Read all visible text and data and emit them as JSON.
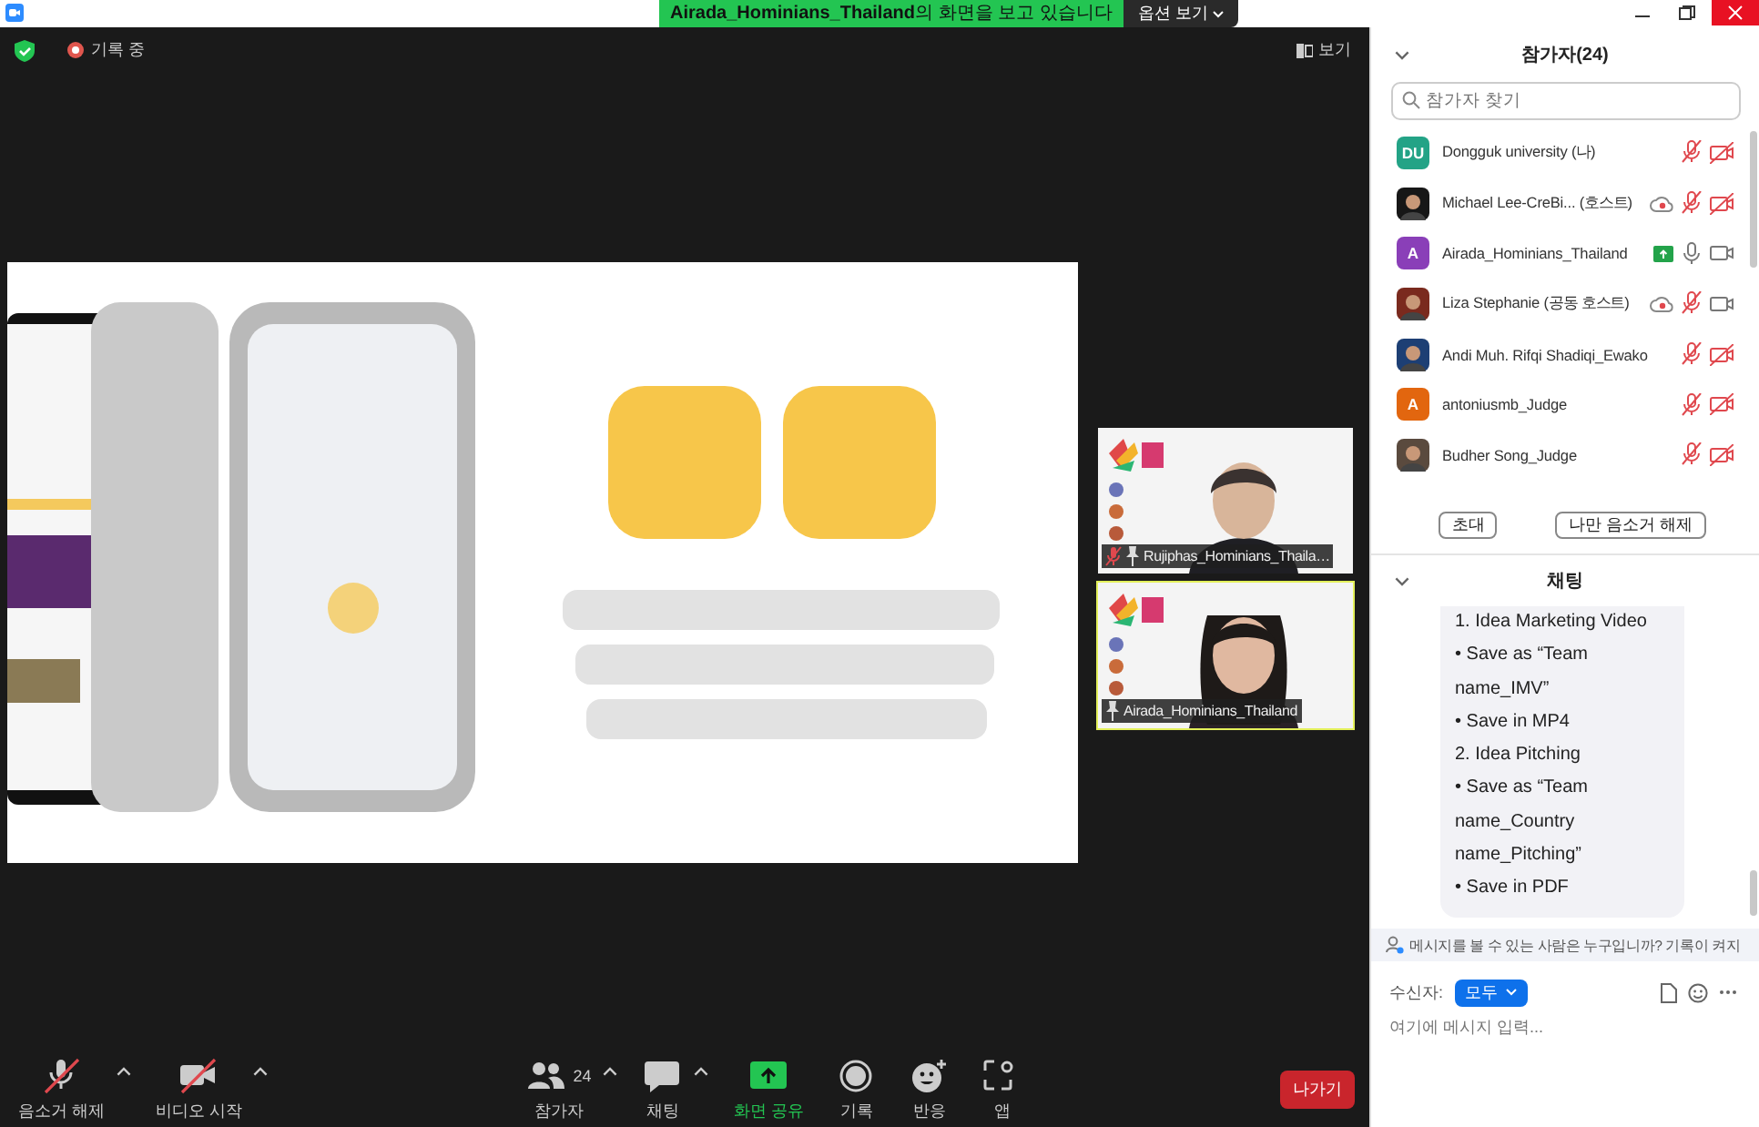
{
  "title_bar": {
    "banner": "**Airada_Hominians_Thailand**의 화면을 보고 있습니다",
    "options_button": "옵션 보기"
  },
  "meeting": {
    "recording_label": "기록 중",
    "view_button": "보기",
    "videos": [
      {
        "name": "Rujiphas_Hominians_Thaila…",
        "muted": true,
        "speaking": false
      },
      {
        "name": "Airada_Hominians_Thailand",
        "muted": false,
        "speaking": true
      }
    ]
  },
  "toolbar": {
    "items": [
      {
        "kind": "mic",
        "label": "음소거 해제",
        "muted": true,
        "caret": true
      },
      {
        "kind": "video",
        "label": "비디오 시작",
        "muted": true,
        "caret": true
      },
      {
        "kind": "participants",
        "label": "참가자",
        "count": "24",
        "caret": true
      },
      {
        "kind": "chat",
        "label": "채팅",
        "caret": true
      },
      {
        "kind": "share",
        "label": "화면 공유",
        "caret": false
      },
      {
        "kind": "record",
        "label": "기록",
        "caret": false
      },
      {
        "kind": "reactions",
        "label": "반응",
        "caret": false
      },
      {
        "kind": "apps",
        "label": "앱",
        "caret": false
      }
    ],
    "leave_button": "나가기"
  },
  "participants_panel": {
    "title": "참가자(24)",
    "search": {
      "placeholder": "참가자 찾기"
    },
    "participants": [
      {
        "name": "Dongguk university (나)",
        "avatar": {
          "kind": "initials",
          "text": "DU",
          "color": "#23a386"
        },
        "recording": false,
        "sharing": false,
        "mic_muted": true,
        "video_off": true
      },
      {
        "name": "Michael Lee-CreBi...  (호스트)",
        "recording": true,
        "sharing": false,
        "mic_muted": true,
        "video_off": true
      },
      {
        "name": "Airada_Hominians_Thailand",
        "avatar": {
          "kind": "initials",
          "text": "A",
          "color": "#8a3fb8"
        },
        "recording": false,
        "sharing": true,
        "mic_muted": false,
        "video_off": false
      },
      {
        "name": "Liza Stephanie (공동 호스트)",
        "recording": true,
        "sharing": false,
        "mic_muted": true,
        "video_off": false
      },
      {
        "name": "Andi Muh. Rifqi Shadiqi_Ewako",
        "recording": false,
        "sharing": false,
        "mic_muted": true,
        "video_off": true
      },
      {
        "name": "antoniusmb_Judge",
        "avatar": {
          "kind": "initials",
          "text": "A",
          "color": "#e2660f"
        },
        "recording": false,
        "sharing": false,
        "mic_muted": true,
        "video_off": true
      },
      {
        "name": "Budher Song_Judge",
        "recording": false,
        "sharing": false,
        "mic_muted": true,
        "video_off": true
      }
    ],
    "buttons": [
      "초대",
      "나만 음소거 해제"
    ]
  },
  "chat_panel": {
    "title": "채팅",
    "message_lines": [
      "1. Idea Marketing Video",
      "• Save as “Team name_IMV”",
      "• Save in MP4",
      "2. Idea Pitching",
      "• Save as “Team name_Country name_Pitching”",
      "• Save in PDF"
    ],
    "notice": "메시지를 볼 수 있는 사람은 누구입니까? 기록이 켜지",
    "recipient_label": "수신자:",
    "recipient": "모두",
    "input": {
      "placeholder": "여기에 메시지 입력..."
    }
  }
}
